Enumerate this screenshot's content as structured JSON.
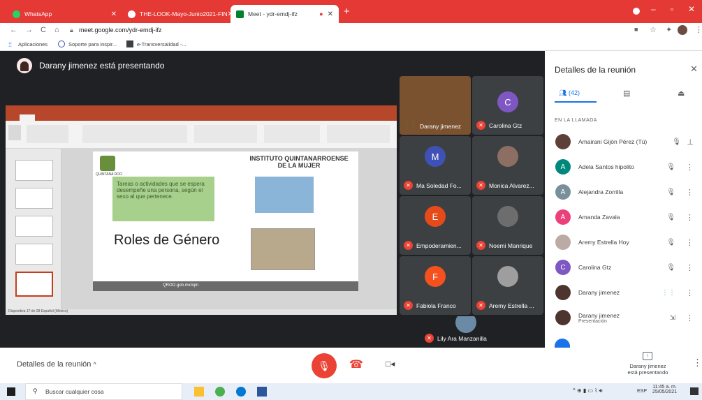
{
  "browser": {
    "tabs": [
      {
        "label": "WhatsApp",
        "active": false
      },
      {
        "label": "THE-LOOK-Mayo-Junio2021-FIN",
        "active": false
      },
      {
        "label": "Meet - ydr-emdj-ifz",
        "active": true
      }
    ],
    "url": "meet.google.com/ydr-emdj-ifz",
    "bookmarks": [
      "Aplicaciones",
      "Soporte para inspir...",
      "e-Transversalidad -..."
    ]
  },
  "meeting": {
    "presenting_banner": "Darany jimenez está presentando",
    "slide": {
      "heading": "INSTITUTO QUINTANARROENSE DE LA MUJER",
      "box_text": "Tareas o actividades que se espera desempeñe una persona, según el sexo al que pertenece.",
      "title": "Roles de Género",
      "footer": "QROO.gob.mx/iqm",
      "logo_text": "QUINTANA ROO",
      "status_left": "Diapositiva 17 de 28   Español (México)"
    },
    "tiles": [
      {
        "name": "Darany jimenez",
        "initial": "",
        "color": "#7a5230",
        "muted": false
      },
      {
        "name": "Carolina Gtz",
        "initial": "C",
        "color": "#7e57c2",
        "muted": true
      },
      {
        "name": "Ma Soledad Fo...",
        "initial": "M",
        "color": "#3f51b5",
        "muted": true
      },
      {
        "name": "Monica Alvarez...",
        "initial": "",
        "color": "#8d6e63",
        "muted": true
      },
      {
        "name": "Empoderamien...",
        "initial": "E",
        "color": "#e64a19",
        "muted": true
      },
      {
        "name": "Noemi Manrique",
        "initial": "",
        "color": "#6d6d6d",
        "muted": true
      },
      {
        "name": "Fabiola Franco",
        "initial": "F",
        "color": "#f4511e",
        "muted": true
      },
      {
        "name": "Aremy Estrella ...",
        "initial": "",
        "color": "#9e9e9e",
        "muted": true
      },
      {
        "name": "Lily Ara Manzanilla",
        "initial": "",
        "color": "#6a8aa6",
        "muted": true
      }
    ]
  },
  "panel": {
    "title": "Detalles de la reunión",
    "people_count": "(42)",
    "section": "EN LA LLAMADA",
    "participants": [
      {
        "name": "Amairani Gijón Pérez (Tú)",
        "initial": "",
        "color": "#5d4037",
        "sub": ""
      },
      {
        "name": "Adela Santos hipolito",
        "initial": "A",
        "color": "#00897b",
        "sub": ""
      },
      {
        "name": "Alejandra Zorrilla",
        "initial": "A",
        "color": "#78909c",
        "sub": ""
      },
      {
        "name": "Amanda Zavala",
        "initial": "A",
        "color": "#ec407a",
        "sub": ""
      },
      {
        "name": "Aremy Estrella Hoy",
        "initial": "",
        "color": "#bcaaa4",
        "sub": ""
      },
      {
        "name": "Carolina Gtz",
        "initial": "C",
        "color": "#7e57c2",
        "sub": ""
      },
      {
        "name": "Darany jimenez",
        "initial": "",
        "color": "#4e342e",
        "sub": ""
      },
      {
        "name": "Darany jimenez",
        "initial": "",
        "color": "#4e342e",
        "sub": "Presentación"
      }
    ]
  },
  "bottom": {
    "details": "Detalles de la reunión",
    "presenting_line1": "Darany jimenez",
    "presenting_line2": "está presentando"
  },
  "taskbar": {
    "search": "Buscar cualquier cosa",
    "lang": "ESP",
    "time": "11:45 a. m.",
    "date": "25/05/2021"
  }
}
